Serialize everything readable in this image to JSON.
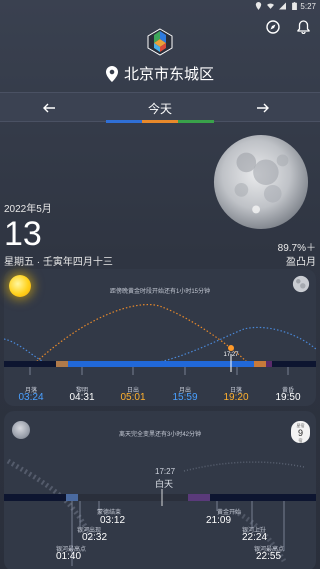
{
  "status": {
    "time": "5:27"
  },
  "location": {
    "name": "北京市东城区"
  },
  "nav": {
    "today": "今天",
    "tab_colors": [
      "#2f6fd6",
      "#e8892b",
      "#39a24a"
    ]
  },
  "date": {
    "year_month": "2022年5月",
    "day": "13",
    "lunar": "星期五 · 壬寅年四月十三"
  },
  "moon": {
    "illumination": "89.7%＋",
    "phase": "盈凸月"
  },
  "sun_card": {
    "note": "距傍晚黄金时段开始还有1小时15分钟",
    "now_label": "17:27",
    "events": [
      {
        "label": "月落",
        "time": "03:24",
        "color": "#4aa0ff"
      },
      {
        "label": "黎明",
        "time": "04:31",
        "color": "#ffffff"
      },
      {
        "label": "日出",
        "time": "05:01",
        "color": "#ffb02e"
      },
      {
        "label": "月出",
        "time": "15:59",
        "color": "#4aa0ff"
      },
      {
        "label": "日落",
        "time": "19:20",
        "color": "#ffb02e"
      },
      {
        "label": "黄昏",
        "time": "19:50",
        "color": "#ffffff"
      }
    ]
  },
  "night_card": {
    "note": "离天完全变黑还有3小时42分钟",
    "now_label": "17:27",
    "daytime": "白天",
    "nakshatra": {
      "top": "星宿",
      "num": "9",
      "bot": "宿"
    },
    "events": [
      {
        "label": "蒙德结束",
        "time": "03:12"
      },
      {
        "label": "黄金开始",
        "time": "21:09"
      },
      {
        "label": "银河出现",
        "time": "02:32"
      },
      {
        "label": "银河上升",
        "time": "22:24"
      },
      {
        "label": "银河最高点",
        "time": "01:40"
      },
      {
        "label": "银河最高点",
        "time": "22:55"
      }
    ]
  }
}
